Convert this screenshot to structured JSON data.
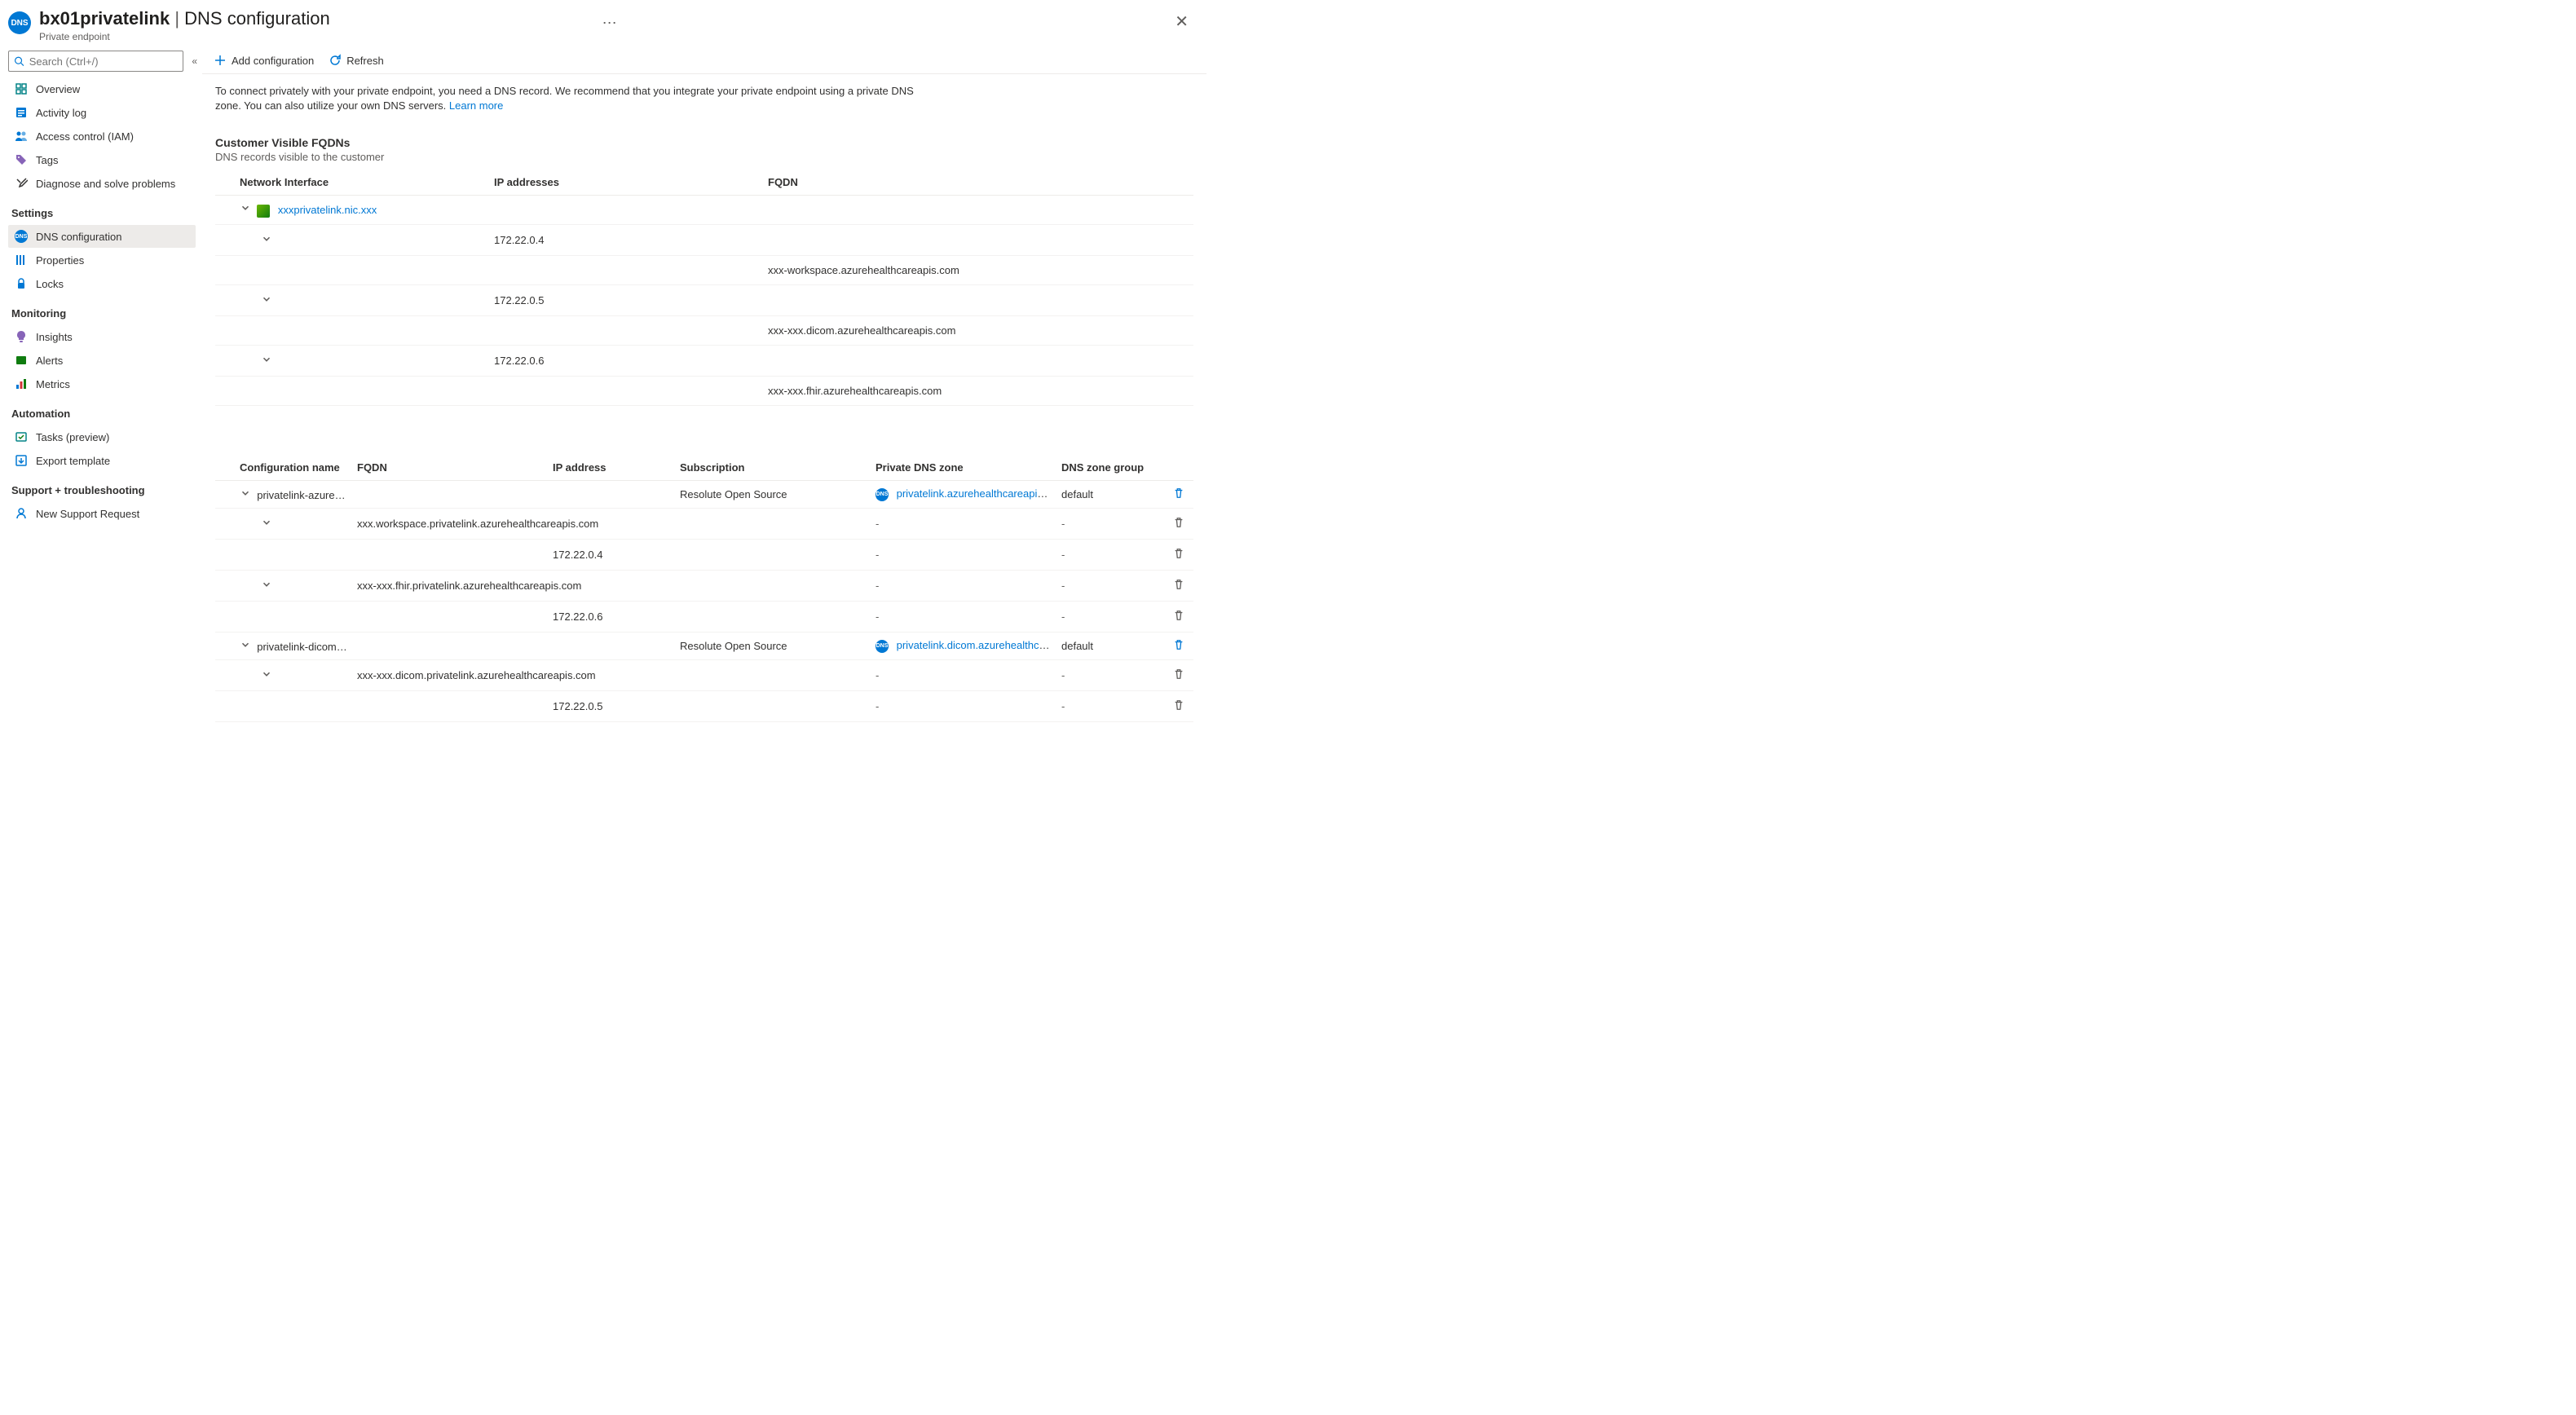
{
  "header": {
    "resource_name": "bx01privatelink",
    "section": "DNS configuration",
    "subtitle": "Private endpoint",
    "icon_label": "DNS"
  },
  "search": {
    "placeholder": "Search (Ctrl+/)"
  },
  "nav": {
    "top": [
      {
        "label": "Overview"
      },
      {
        "label": "Activity log"
      },
      {
        "label": "Access control (IAM)"
      },
      {
        "label": "Tags"
      },
      {
        "label": "Diagnose and solve problems"
      }
    ],
    "settings_title": "Settings",
    "settings": [
      {
        "label": "DNS configuration",
        "active": true
      },
      {
        "label": "Properties"
      },
      {
        "label": "Locks"
      }
    ],
    "monitoring_title": "Monitoring",
    "monitoring": [
      {
        "label": "Insights"
      },
      {
        "label": "Alerts"
      },
      {
        "label": "Metrics"
      }
    ],
    "automation_title": "Automation",
    "automation": [
      {
        "label": "Tasks (preview)"
      },
      {
        "label": "Export template"
      }
    ],
    "support_title": "Support + troubleshooting",
    "support": [
      {
        "label": "New Support Request"
      }
    ]
  },
  "cmdbar": {
    "add": "Add configuration",
    "refresh": "Refresh"
  },
  "info": {
    "text": "To connect privately with your private endpoint, you need a DNS record. We recommend that you integrate your private endpoint using a private DNS zone. You can also utilize your own DNS servers. ",
    "learn_more": "Learn more"
  },
  "fqdn_section": {
    "title": "Customer Visible FQDNs",
    "subtitle": "DNS records visible to the customer",
    "cols": {
      "nic": "Network Interface",
      "ip": "IP addresses",
      "fqdn": "FQDN"
    },
    "nic_link": "xxxprivatelink.nic.xxx",
    "rows": [
      {
        "ip": "172.22.0.4",
        "fqdn": "xxx-workspace.azurehealthcareapis.com"
      },
      {
        "ip": "172.22.0.5",
        "fqdn": "xxx-xxx.dicom.azurehealthcareapis.com"
      },
      {
        "ip": "172.22.0.6",
        "fqdn": "xxx-xxx.fhir.azurehealthcareapis.com"
      }
    ]
  },
  "config_table": {
    "cols": {
      "name": "Configuration name",
      "fqdn": "FQDN",
      "ip": "IP address",
      "sub": "Subscription",
      "zone": "Private DNS zone",
      "group": "DNS zone group"
    },
    "groups": [
      {
        "name": "privatelink-azurehea...",
        "subscription": "Resolute Open Source",
        "zone": "privatelink.azurehealthcareapis.com",
        "zone_group": "default",
        "records": [
          {
            "fqdn": "xxx.workspace.privatelink.azurehealthcareapis.com",
            "ip": "172.22.0.4"
          },
          {
            "fqdn": "xxx-xxx.fhir.privatelink.azurehealthcareapis.com",
            "ip": "172.22.0.6"
          }
        ]
      },
      {
        "name": "privatelink-dicom-az...",
        "subscription": "Resolute Open Source",
        "zone": "privatelink.dicom.azurehealthcarea...",
        "zone_group": "default",
        "records": [
          {
            "fqdn": "xxx-xxx.dicom.privatelink.azurehealthcareapis.com",
            "ip": "172.22.0.5"
          }
        ]
      }
    ]
  }
}
